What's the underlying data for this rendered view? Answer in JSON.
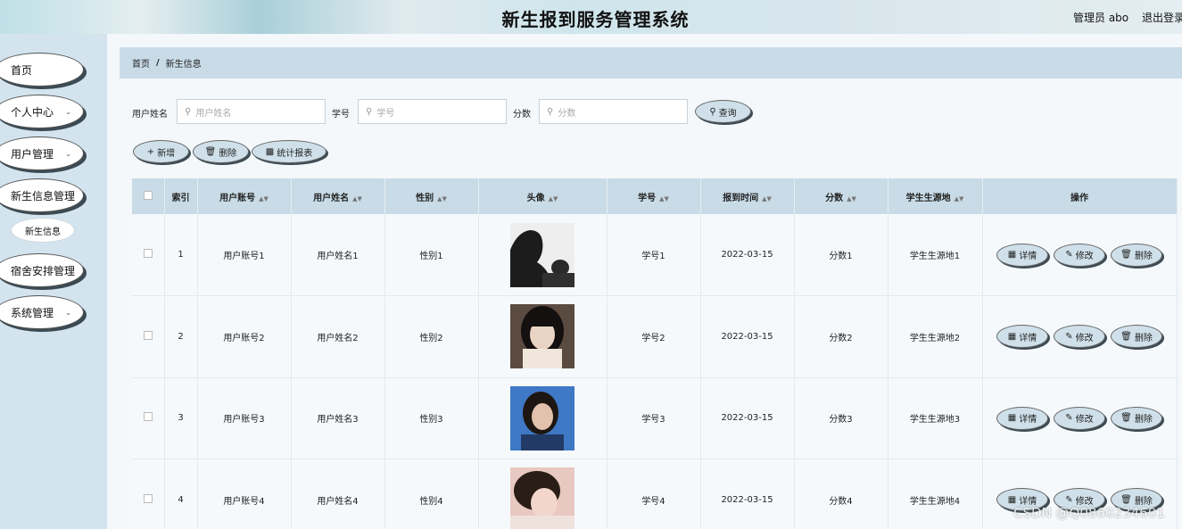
{
  "header": {
    "title": "新生报到服务管理系统",
    "user": "管理员 abo",
    "logout": "退出登录"
  },
  "sidebar": {
    "items": [
      {
        "label": "首页"
      },
      {
        "label": "个人中心"
      },
      {
        "label": "用户管理"
      },
      {
        "label": "新生信息管理"
      },
      {
        "label": "宿舍安排管理"
      },
      {
        "label": "系统管理"
      }
    ],
    "submenu": [
      {
        "label": "新生信息"
      }
    ]
  },
  "breadcrumb": {
    "home": "首页",
    "separator": "/",
    "current": "新生信息"
  },
  "search": {
    "username_label": "用户姓名",
    "username_placeholder": "用户姓名",
    "studentid_label": "学号",
    "studentid_placeholder": "学号",
    "score_label": "分数",
    "score_placeholder": "分数",
    "query_button": "查询"
  },
  "toolbar": {
    "add_label": "新增",
    "delete_label": "删除",
    "report_label": "统计报表"
  },
  "table": {
    "columns": [
      "索引",
      "用户账号",
      "用户姓名",
      "性别",
      "头像",
      "学号",
      "报到时间",
      "分数",
      "学生生源地",
      "操作"
    ],
    "rows": [
      {
        "index": "1",
        "account": "用户账号1",
        "name": "用户姓名1",
        "gender": "性别1",
        "student_id": "学号1",
        "date": "2022-03-15",
        "score": "分数1",
        "origin": "学生生源地1"
      },
      {
        "index": "2",
        "account": "用户账号2",
        "name": "用户姓名2",
        "gender": "性别2",
        "student_id": "学号2",
        "date": "2022-03-15",
        "score": "分数2",
        "origin": "学生生源地2"
      },
      {
        "index": "3",
        "account": "用户账号3",
        "name": "用户姓名3",
        "gender": "性别3",
        "student_id": "学号3",
        "date": "2022-03-15",
        "score": "分数3",
        "origin": "学生生源地3"
      },
      {
        "index": "4",
        "account": "用户账号4",
        "name": "用户姓名4",
        "gender": "性别4",
        "student_id": "学号4",
        "date": "2022-03-15",
        "score": "分数4",
        "origin": "学生生源地4"
      }
    ],
    "actions": {
      "detail": "详情",
      "edit": "修改",
      "delete": "删除"
    }
  },
  "watermark": "CSDN @Q0860234601"
}
